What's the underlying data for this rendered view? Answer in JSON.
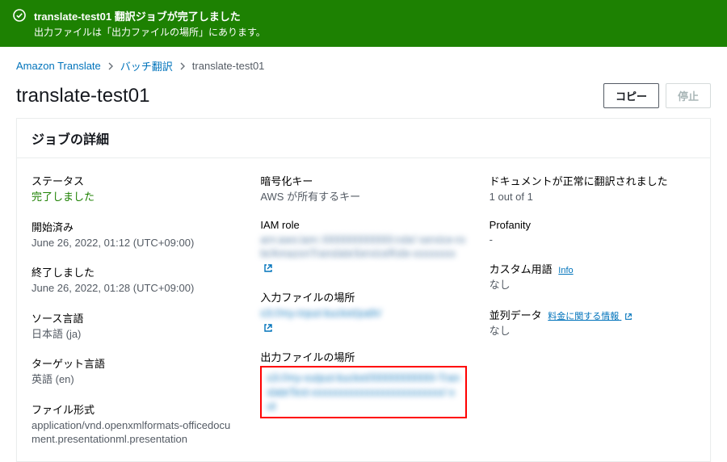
{
  "banner": {
    "title": "translate-test01 翻訳ジョブが完了しました",
    "message": "出力ファイルは「出力ファイルの場所」にあります。"
  },
  "breadcrumbs": {
    "service": "Amazon Translate",
    "section": "バッチ翻訳",
    "current": "translate-test01"
  },
  "page": {
    "title": "translate-test01"
  },
  "actions": {
    "copy": "コピー",
    "stop": "停止"
  },
  "panel": {
    "header": "ジョブの詳細"
  },
  "col1": {
    "status_label": "ステータス",
    "status_value": "完了しました",
    "started_label": "開始済み",
    "started_value": "June 26, 2022, 01:12 (UTC+09:00)",
    "ended_label": "終了しました",
    "ended_value": "June 26, 2022, 01:28 (UTC+09:00)",
    "source_label": "ソース言語",
    "source_value": "日本語 (ja)",
    "target_label": "ターゲット言語",
    "target_value": "英語 (en)",
    "filetype_label": "ファイル形式",
    "filetype_value": "application/vnd.openxmlformats-officedocument.presentationml.presentation"
  },
  "col2": {
    "enc_label": "暗号化キー",
    "enc_value": "AWS が所有するキー",
    "iam_label": "IAM role",
    "iam_value_blur": "arn:aws:iam::000000000000:role/ service-role/AmazonTranslateServiceRole-xxxxxxxx",
    "input_label": "入力ファイルの場所",
    "input_value_blur": "s3://my-input-bucket/path/",
    "output_label": "出力ファイルの場所",
    "output_value_blur": "s3://my-output-bucket/00000000000-TranslateText-xxxxxxxxxxxxxxxxxxxxxxxxx/ out"
  },
  "col3": {
    "docs_label": "ドキュメントが正常に翻訳されました",
    "docs_value": "1 out of 1",
    "profanity_label": "Profanity",
    "profanity_value": "-",
    "terms_label": "カスタム用語",
    "info_text": "Info",
    "terms_value": "なし",
    "parallel_label": "並列データ",
    "pricing_link": "料金に関する情報",
    "parallel_value": "なし"
  }
}
